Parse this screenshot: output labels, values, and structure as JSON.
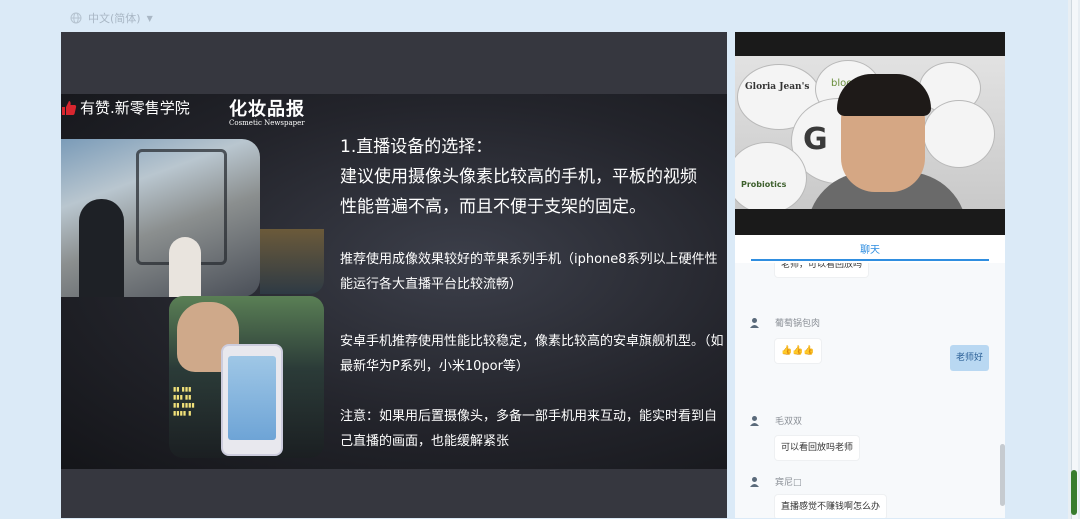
{
  "topbar": {
    "language": "中文(简体)"
  },
  "slide": {
    "brand_left": "有赞.新零售学院",
    "brand_right": "化妆品报",
    "brand_right_sub": "Cosmetic Newspaper",
    "heading_line1": "1.直播设备的选择：",
    "heading_line2": "建议使用摄像头像素比较高的手机，平板的视频",
    "heading_line3": "性能普遍不高，而且不便于支架的固定。",
    "p1": "推荐使用成像效果较好的苹果系列手机（iphone8系列以上硬件性能运行各大直播平台比较流畅）",
    "p2": "安卓手机推荐使用性能比较稳定，像素比较高的安卓旗舰机型。（如最新华为P系列，小米10por等）",
    "p3": "注意：如果用后置摄像头，多备一部手机用来互动，能实时看到自己直播的画面，也能缓解紧张"
  },
  "video": {
    "logos": [
      "Gloria Jean's",
      "bloom",
      "Probiotics"
    ]
  },
  "chat": {
    "tab_label": "聊天",
    "messages": [
      {
        "user": "",
        "text": "老师，可以看回放吗"
      },
      {
        "user": "葡萄锅包肉",
        "text": "👍👍👍"
      },
      {
        "self": true,
        "text": "老师好"
      },
      {
        "user": "毛双双",
        "text": "可以看回放吗老师"
      },
      {
        "user": "宾尼□",
        "text": "直播感觉不赚钱啊怎么办"
      }
    ]
  },
  "colors": {
    "accent": "#2f8ee0",
    "page_bg": "#dbeaf7",
    "self_bubble": "#b9d8f2"
  }
}
